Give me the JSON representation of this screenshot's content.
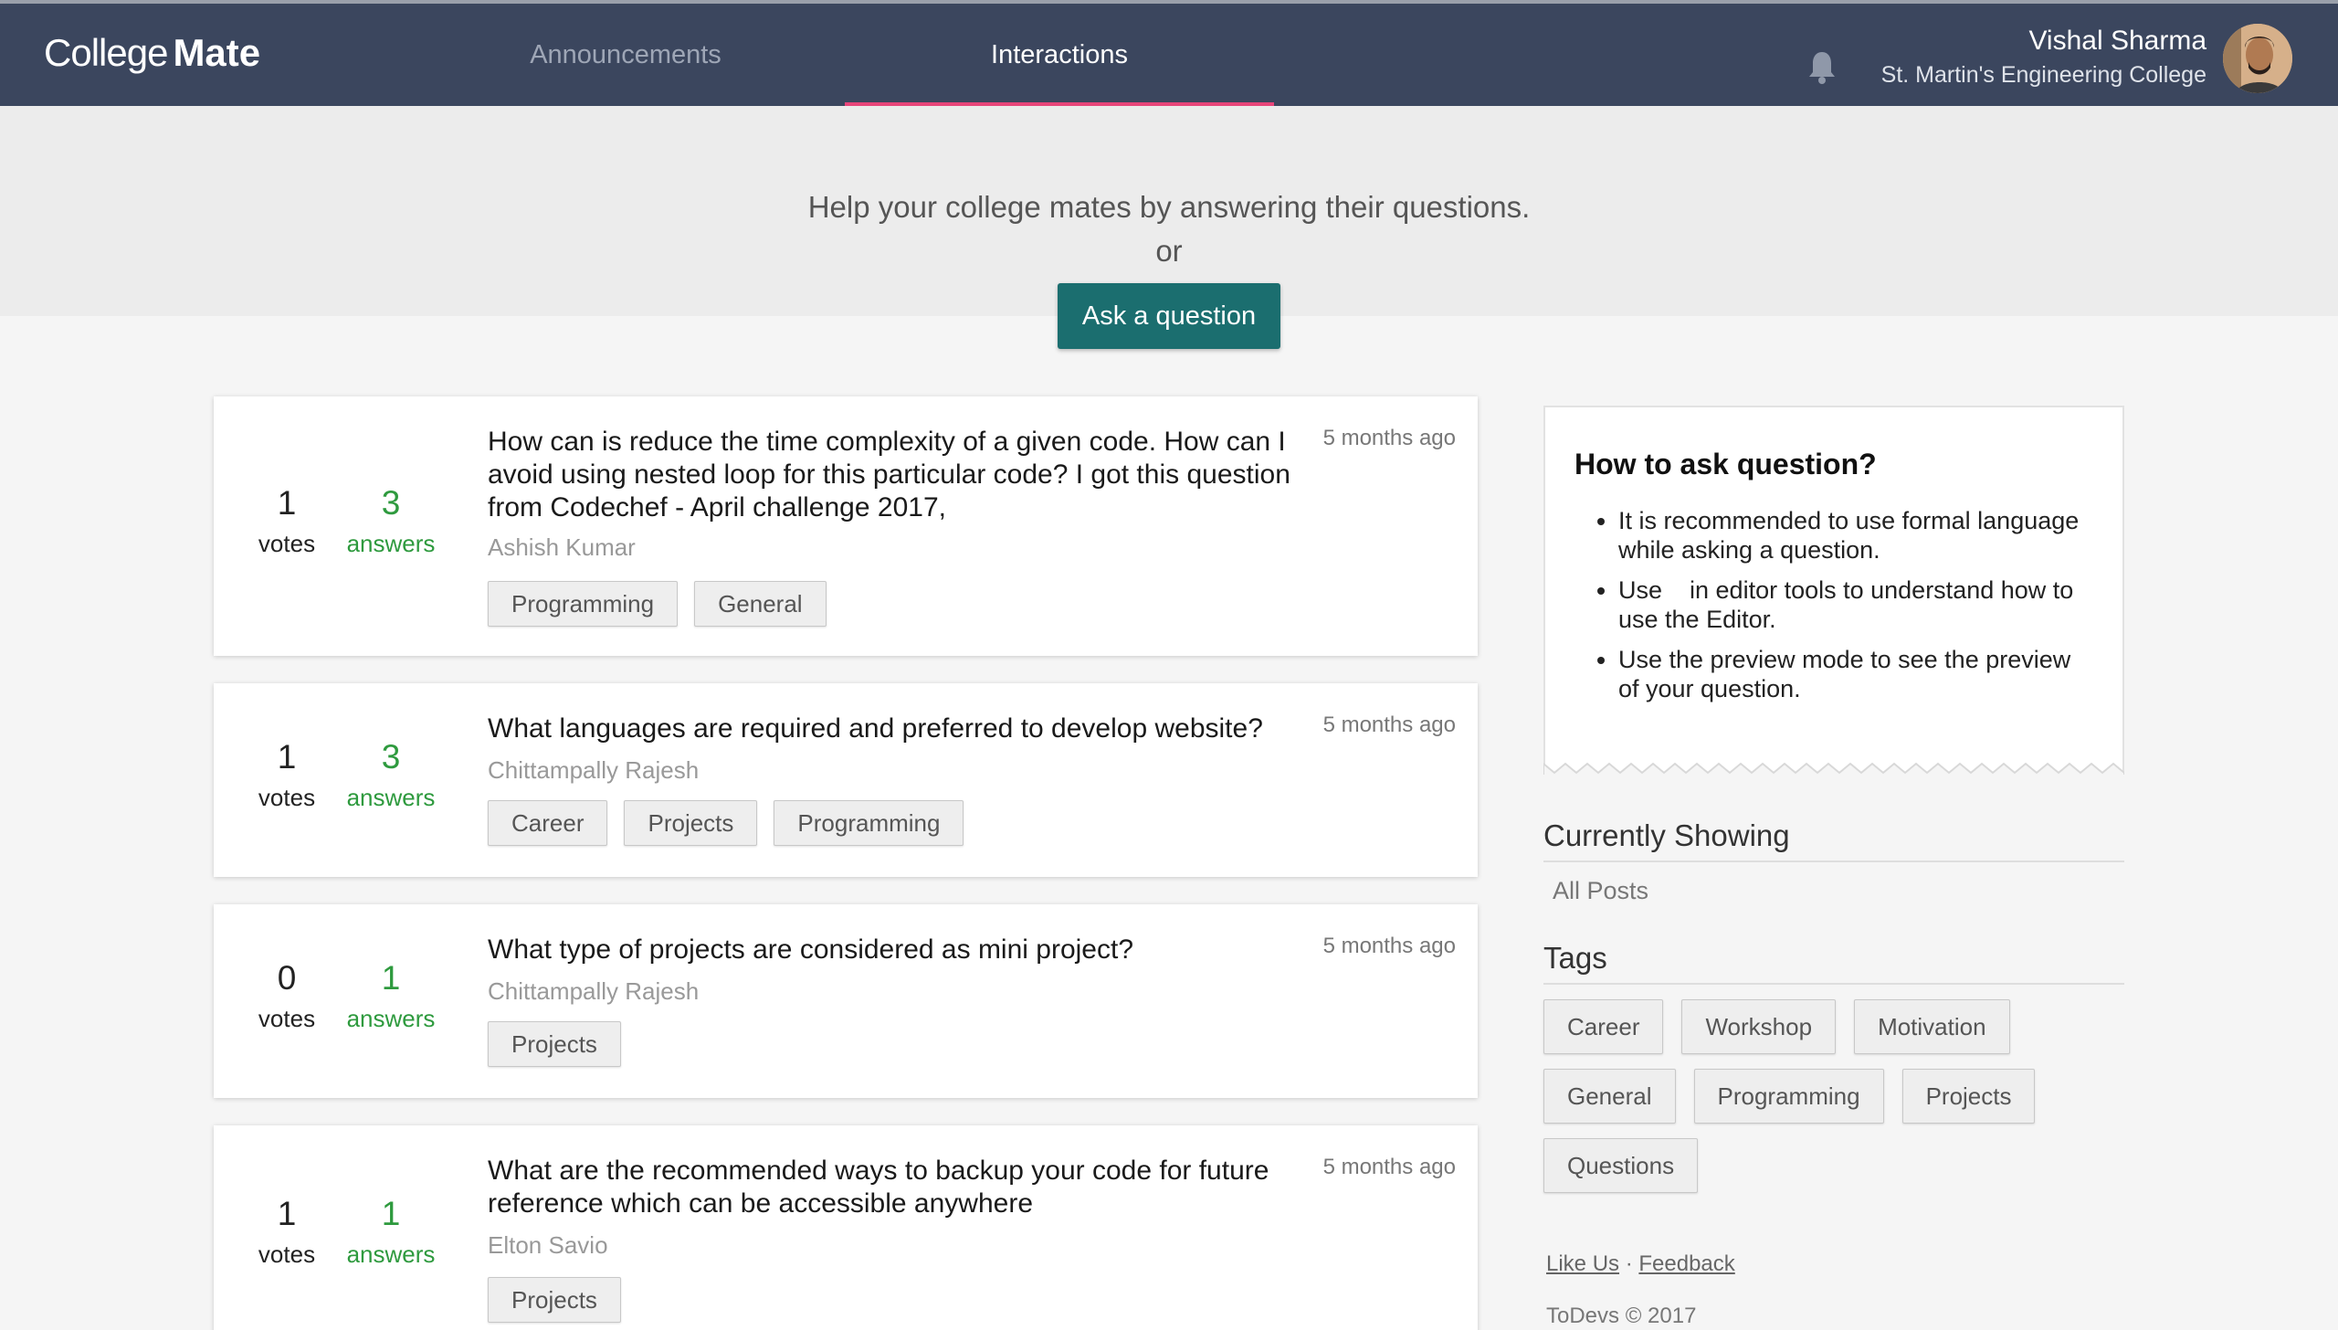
{
  "header": {
    "logo_light": "College",
    "logo_bold": "Mate",
    "nav": [
      {
        "label": "Announcements"
      },
      {
        "label": "Interactions"
      }
    ],
    "user_name": "Vishal Sharma",
    "user_college": "St. Martin's Engineering College"
  },
  "hero": {
    "line1": "Help your college mates by answering their questions.",
    "line2": "or",
    "ask_button": "Ask a question"
  },
  "questions": [
    {
      "votes": "1",
      "votes_label": "votes",
      "answers": "3",
      "answers_label": "answers",
      "title": "How can is reduce the time complexity of a given code. How can I avoid using nested loop for this particular code? I got this question from Codechef - April challenge 2017,",
      "time": "5 months ago",
      "author": "Ashish Kumar",
      "tags": [
        "Programming",
        "General"
      ]
    },
    {
      "votes": "1",
      "votes_label": "votes",
      "answers": "3",
      "answers_label": "answers",
      "title": "What languages are required and preferred to develop website?",
      "time": "5 months ago",
      "author": "Chittampally Rajesh",
      "tags": [
        "Career",
        "Projects",
        "Programming"
      ]
    },
    {
      "votes": "0",
      "votes_label": "votes",
      "answers": "1",
      "answers_label": "answers",
      "title": "What type of projects are considered as mini project?",
      "time": "5 months ago",
      "author": "Chittampally Rajesh",
      "tags": [
        "Projects"
      ]
    },
    {
      "votes": "1",
      "votes_label": "votes",
      "answers": "1",
      "answers_label": "answers",
      "title": "What are the recommended ways to backup your code for future reference which can be accessible anywhere",
      "time": "5 months ago",
      "author": "Elton Savio",
      "tags": [
        "Projects"
      ]
    }
  ],
  "sidebar": {
    "howto_title": "How to ask question?",
    "howto_items": [
      "It is recommended to use formal language while asking a question.",
      "Use    in editor tools to understand how to use the Editor.",
      "Use the preview mode to see the preview of your question."
    ],
    "showing_title": "Currently Showing",
    "showing_value": "All Posts",
    "tags_title": "Tags",
    "tags": [
      "Career",
      "Workshop",
      "Motivation",
      "General",
      "Programming",
      "Projects",
      "Questions"
    ]
  },
  "footer": {
    "like_us": "Like Us",
    "separator": "·",
    "feedback": "Feedback",
    "copyright": "ToDevs © 2017"
  },
  "colors": {
    "topbar": "#3b465e",
    "active_underline": "#e8457a",
    "ask_button": "#1b6e6f",
    "answers": "#2e9a3e"
  },
  "icons": [
    "bell-icon",
    "avatar"
  ]
}
